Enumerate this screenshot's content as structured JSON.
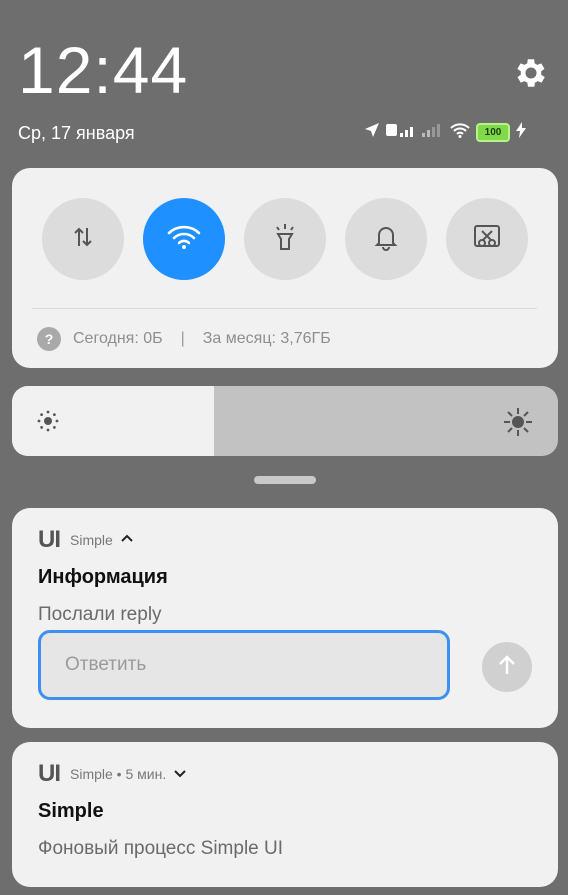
{
  "header": {
    "time": "12:44",
    "date": "Ср, 17 января",
    "battery": "100"
  },
  "quick_settings": {
    "tiles": [
      {
        "name": "mobile-data",
        "icon": "data-arrows-icon",
        "active": false
      },
      {
        "name": "wifi",
        "icon": "wifi-icon",
        "active": true
      },
      {
        "name": "flashlight",
        "icon": "flashlight-icon",
        "active": false
      },
      {
        "name": "sound",
        "icon": "bell-icon",
        "active": false
      },
      {
        "name": "screenshot",
        "icon": "scissors-icon",
        "active": false
      }
    ],
    "usage_today": "Сегодня: 0Б",
    "separator": "|",
    "usage_month": "За месяц: 3,76ГБ",
    "active_color": "#1e90ff"
  },
  "brightness": {
    "level_fraction": 0.37
  },
  "notifications": [
    {
      "app_mark": "UI",
      "app_name": "Simple",
      "title": "Информация",
      "body": "Послали reply",
      "reply_placeholder": "Ответить"
    },
    {
      "app_mark": "UI",
      "app_name": "Simple • 5 мин.",
      "title": "Simple",
      "body": "Фоновый процесс Simple UI"
    }
  ]
}
